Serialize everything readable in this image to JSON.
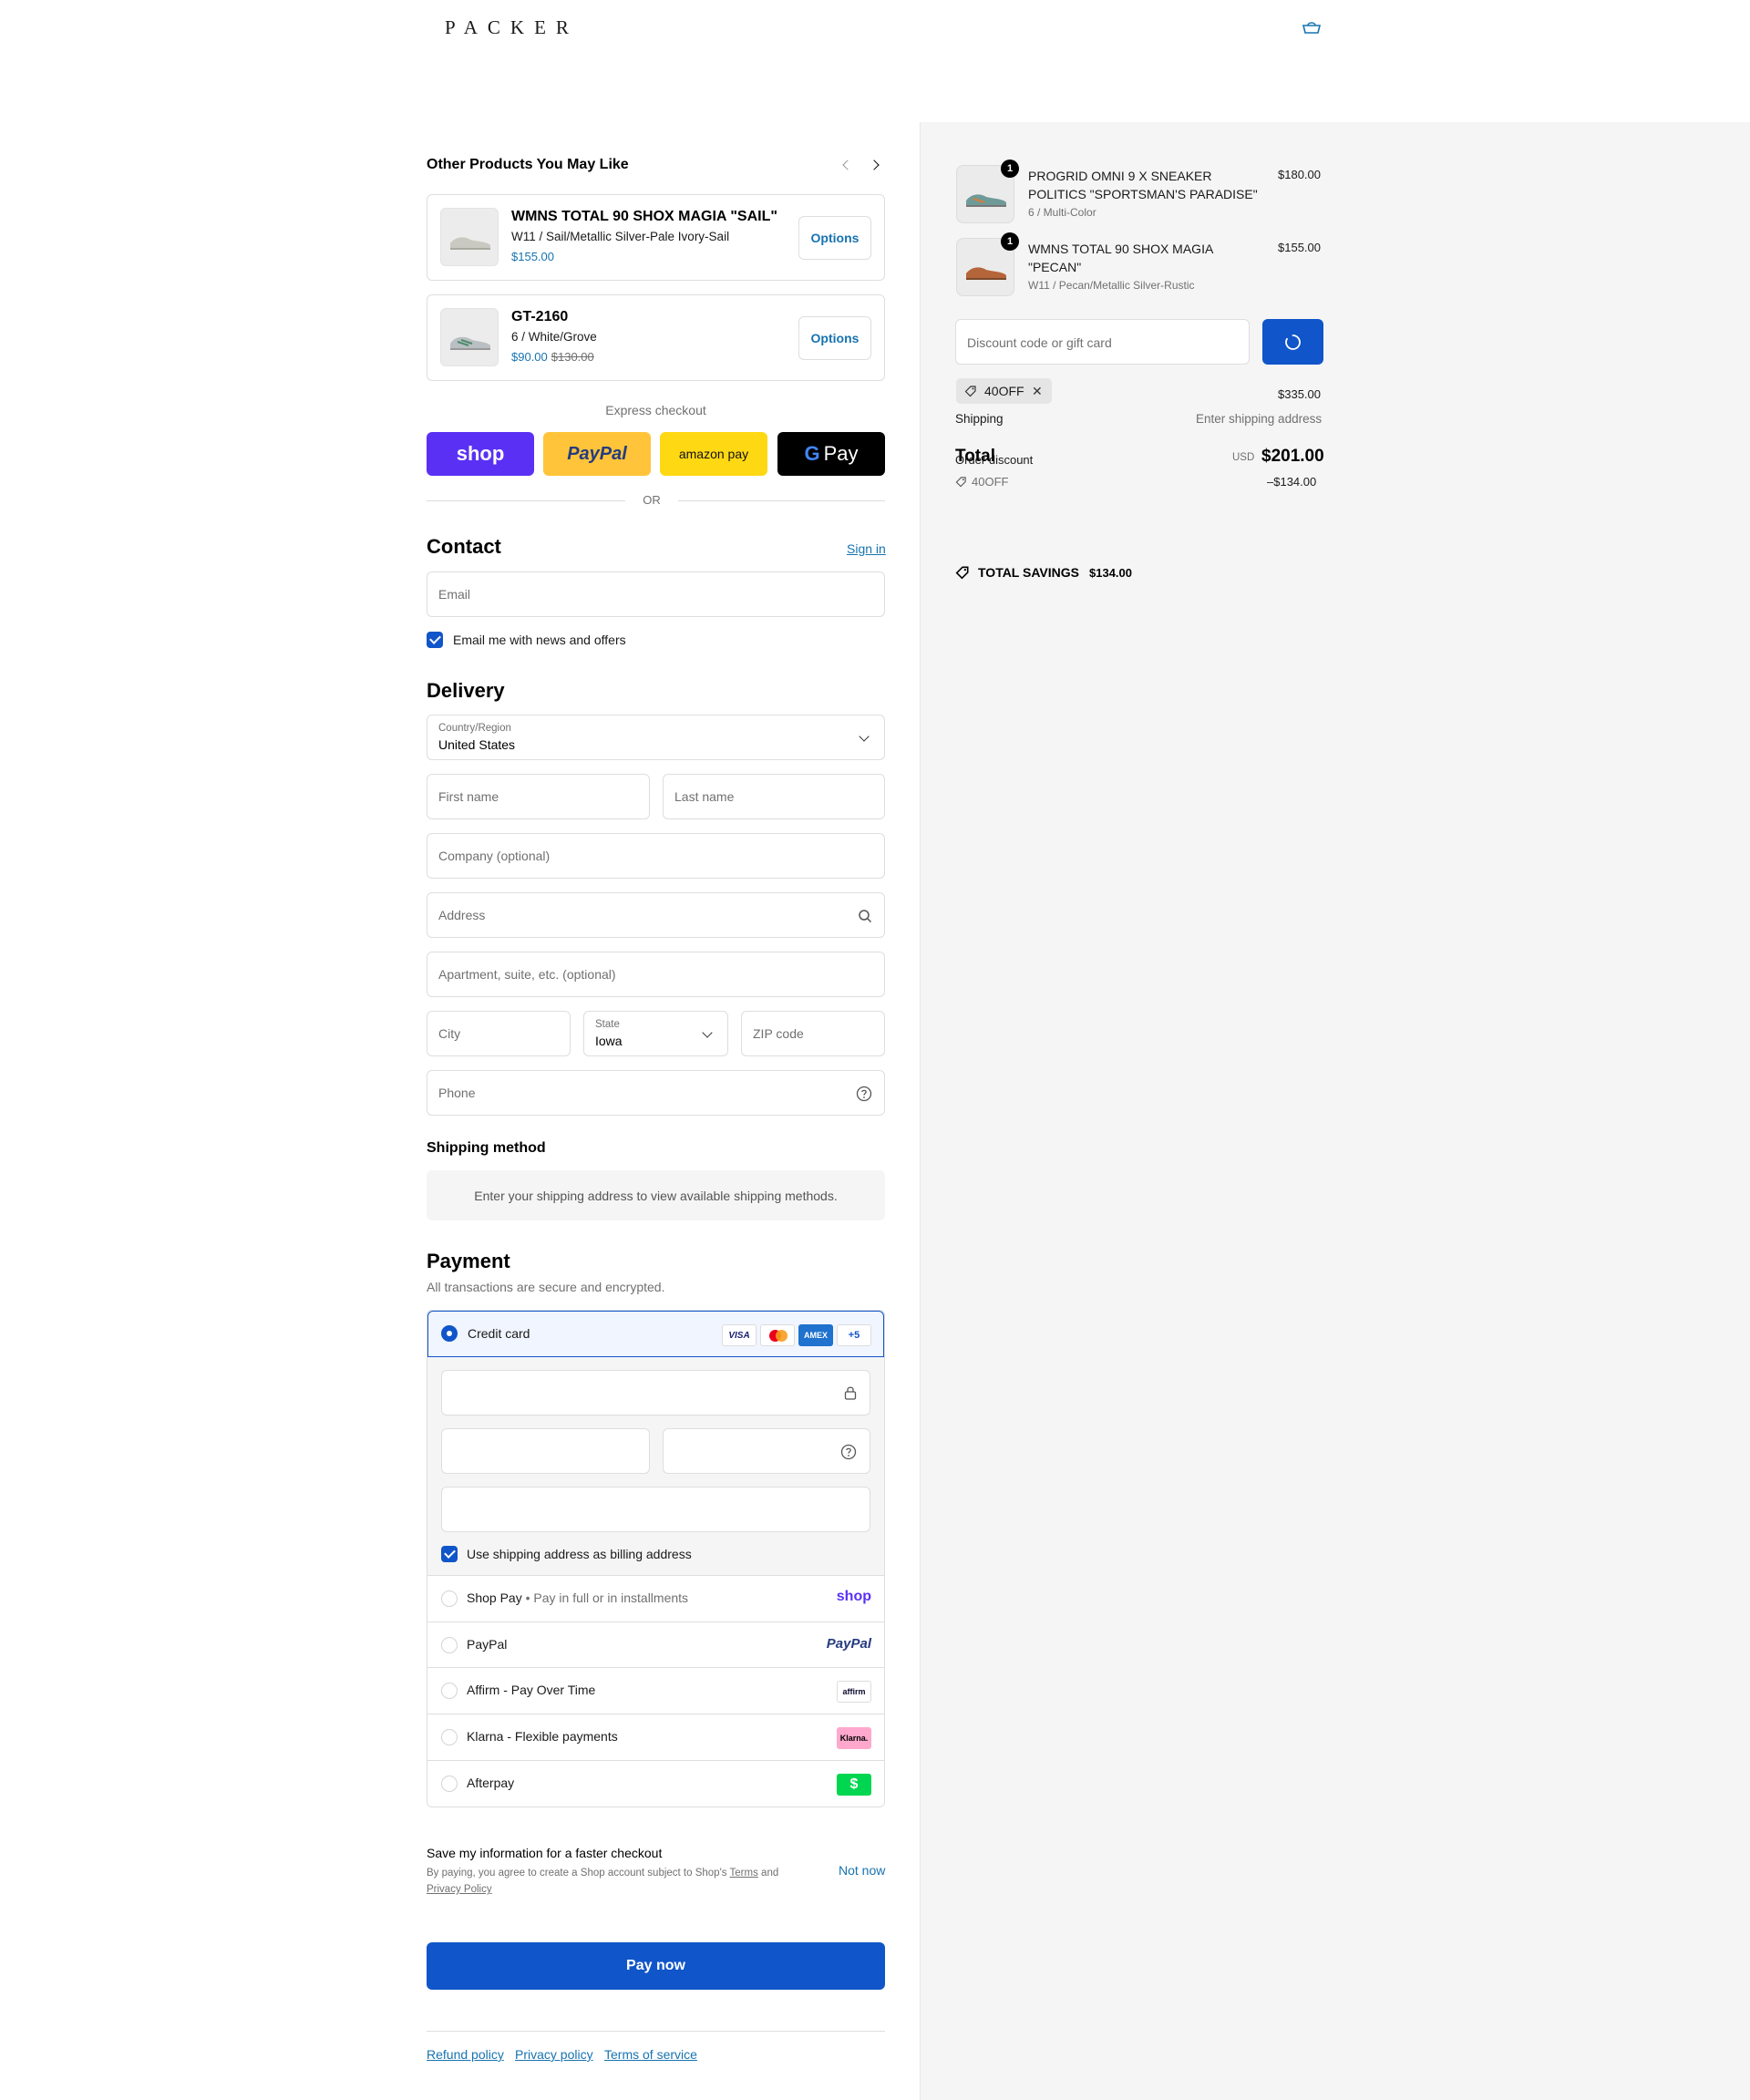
{
  "header": {
    "logo": "PACKER"
  },
  "upsell": {
    "title": "Other Products You May Like",
    "products": [
      {
        "name": "WMNS TOTAL 90 SHOX MAGIA \"SAIL\"",
        "variant": "W11 / Sail/Metallic Silver-Pale Ivory-Sail",
        "price": "$155.00",
        "compare_price": "",
        "button": "Options"
      },
      {
        "name": "GT-2160",
        "variant": "6 / White/Grove",
        "price": "$90.00",
        "compare_price": "$130.00",
        "button": "Options"
      }
    ]
  },
  "express": {
    "label": "Express checkout",
    "buttons": [
      "shop",
      "PayPal",
      "amazon pay",
      "Pay"
    ],
    "or": "OR"
  },
  "contact": {
    "title": "Contact",
    "sign_in": "Sign in",
    "email_placeholder": "Email",
    "newsletter_label": "Email me with news and offers"
  },
  "delivery": {
    "title": "Delivery",
    "country_label": "Country/Region",
    "country_value": "United States",
    "first_name": "First name",
    "last_name": "Last name",
    "company": "Company (optional)",
    "address": "Address",
    "apartment": "Apartment, suite, etc. (optional)",
    "city": "City",
    "state_label": "State",
    "state_value": "Iowa",
    "zip": "ZIP code",
    "phone": "Phone"
  },
  "shipping_method": {
    "title": "Shipping method",
    "notice": "Enter your shipping address to view available shipping methods."
  },
  "payment": {
    "title": "Payment",
    "subtitle": "All transactions are secure and encrypted.",
    "credit_card_label": "Credit card",
    "card_brands": [
      "VISA",
      "Mastercard",
      "AMEX",
      "+5"
    ],
    "billing_same_label": "Use shipping address as billing address",
    "methods": [
      {
        "label": "Shop Pay",
        "sub": "Pay in full or in installments",
        "logo": "shop"
      },
      {
        "label": "PayPal",
        "sub": "",
        "logo": "PayPal"
      },
      {
        "label": "Affirm - Pay Over Time",
        "sub": "",
        "logo": "affirm"
      },
      {
        "label": "Klarna - Flexible payments",
        "sub": "",
        "logo": "Klarna."
      },
      {
        "label": "Afterpay",
        "sub": "",
        "logo": "$"
      }
    ]
  },
  "save_info": {
    "title": "Save my information for a faster checkout",
    "terms_prefix": "By paying, you agree to create a Shop account subject to Shop's",
    "terms": "Terms",
    "and": "and",
    "privacy": "Privacy Policy",
    "not_now": "Not now"
  },
  "pay_now": "Pay now",
  "footer_links": [
    "Refund policy",
    "Privacy policy",
    "Terms of service"
  ],
  "summary": {
    "items": [
      {
        "qty": "1",
        "name": "PROGRID OMNI 9 X SNEAKER POLITICS \"SPORTSMAN'S PARADISE\"",
        "variant": "6 / Multi-Color",
        "price": "$180.00"
      },
      {
        "qty": "1",
        "name": "WMNS TOTAL 90 SHOX MAGIA \"PECAN\"",
        "variant": "W11 / Pecan/Metallic Silver-Rustic",
        "price": "$155.00"
      }
    ],
    "discount_placeholder": "Discount code or gift card",
    "code": "40OFF",
    "subtotal": "$335.00",
    "shipping_label": "Shipping",
    "shipping_value": "Enter shipping address",
    "total_label": "Total",
    "order_discount_label": "Order discount",
    "currency": "USD",
    "total_value": "$201.00",
    "discount_code": "40OFF",
    "discount_value": "–$134.00",
    "total_savings_label": "TOTAL SAVINGS",
    "total_savings_value": "$134.00"
  }
}
